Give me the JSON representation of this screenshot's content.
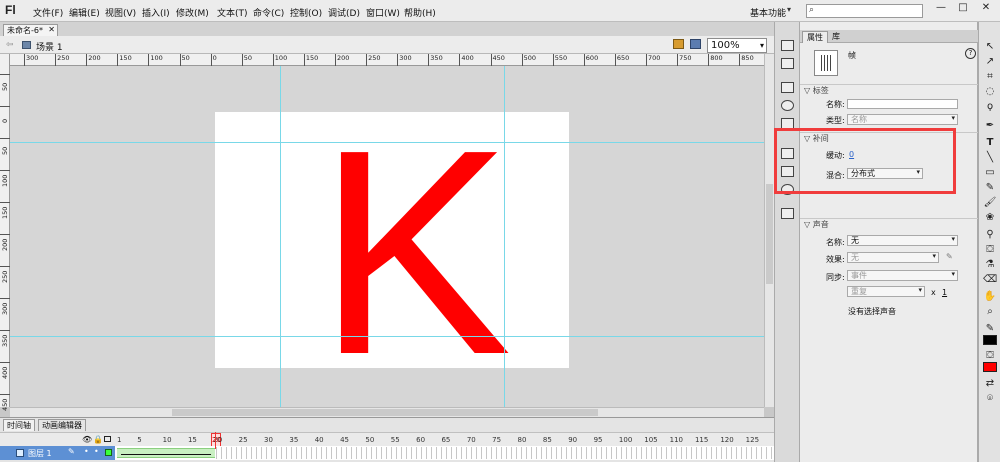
{
  "app": {
    "logo": "Fl",
    "menu": [
      "文件(F)",
      "编辑(E)",
      "视图(V)",
      "插入(I)",
      "修改(M)",
      "文本(T)",
      "命令(C)",
      "控制(O)",
      "调试(D)",
      "窗口(W)",
      "帮助(H)"
    ],
    "workspace": "基本功能",
    "window_buttons": [
      "—",
      "□",
      "✕"
    ]
  },
  "document": {
    "tab_title": "未命名-6*",
    "scene": "场景 1",
    "zoom": "100%"
  },
  "ruler": {
    "top_labels": [
      "300",
      "250",
      "200",
      "150",
      "100",
      "50",
      "0",
      "50",
      "100",
      "150",
      "200",
      "250",
      "300",
      "350",
      "400",
      "450",
      "500",
      "550",
      "600",
      "650",
      "700",
      "750",
      "800",
      "850"
    ],
    "left_labels": [
      "50",
      "0",
      "50",
      "100",
      "150",
      "200",
      "250",
      "300",
      "350",
      "400",
      "450"
    ]
  },
  "stage": {
    "text": "K",
    "text_color": "#ff0000"
  },
  "timeline": {
    "tabs": [
      "时间轴",
      "动画编辑器"
    ],
    "frame_numbers": [
      "1",
      "5",
      "10",
      "15",
      "20",
      "25",
      "30",
      "35",
      "40",
      "45",
      "50",
      "55",
      "60",
      "65",
      "70",
      "75",
      "80",
      "85",
      "90",
      "95",
      "100",
      "105",
      "110",
      "115",
      "120",
      "125"
    ],
    "current_frame": "20",
    "layer_name": "图层 1"
  },
  "properties": {
    "tabs": [
      "属性",
      "库"
    ],
    "frame_title": "帧",
    "label_section": "标签",
    "name_label": "名称:",
    "name_value": "",
    "type_label": "类型:",
    "type_value": "名称",
    "tween_section": "补间",
    "ease_label": "缓动:",
    "ease_value": "0",
    "blend_label": "混合:",
    "blend_value": "分布式",
    "sound_section": "声音",
    "sound_name_label": "名称:",
    "sound_name_value": "无",
    "effect_label": "效果:",
    "effect_value": "无",
    "sync_label": "同步:",
    "sync_value": "事件",
    "repeat_value": "重复",
    "repeat_x": "x",
    "repeat_count": "1",
    "no_sound": "没有选择声音"
  },
  "colors": {
    "highlight": "#f03c3c",
    "fill_swatch": "#ff0000",
    "stroke_swatch": "#000000"
  }
}
